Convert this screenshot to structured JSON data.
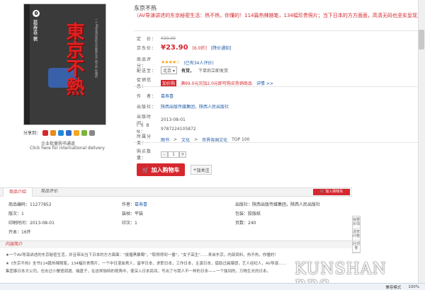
{
  "product": {
    "title": "东京不热",
    "promo": "（AV导演讲述的东京秘密生活：热不热，你懂的！114篇热辣随笔，134幅珍贵照片；当下日本的方方面面，高清无码也坚实呈现）",
    "list_price_label": "定　价：",
    "list_price": "¥30.00",
    "price_label": "京东价：",
    "price": "¥23.90",
    "discount": "[6.0折]",
    "price_notice": "[降价通知]",
    "rating_label": "商品评分：",
    "rating_stars": 4,
    "rating_text": "(已有34人评价)",
    "ship_label": "配送至：",
    "ship_region": "北京",
    "ship_stock": "有货，",
    "ship_note": "下单后立即发货",
    "promo_label": "促销信息：",
    "promo_tag": "加价购",
    "promo_text": "满99.0元另加2.0元即可购买热销商品",
    "promo_link": "详情 >>",
    "author_label": "作　者：",
    "author": "葛寿喜",
    "publisher_label": "出版社：",
    "publisher": "陕西出版传媒集团，陕西人民出版社",
    "pubdate_label": "出版时间：",
    "pubdate": "2013-08-01",
    "isbn_label": "I S B N：",
    "isbn": "9787224105872",
    "category_label": "所属分类：",
    "category": [
      "图书",
      "文化",
      "世界各国文化"
    ],
    "category_sep": ">",
    "category_rank": "TOP 100",
    "qty_label": "购买数量：",
    "qty_minus": "-",
    "qty_value": "1",
    "qty_plus": "+",
    "cart_button": "加入购物车",
    "fav_button": "加关注"
  },
  "cover": {
    "number": "0",
    "big_title": "東京不熱",
    "side_text": "葛寿喜·著",
    "small_text": "一个AV导演讲述的东京秘密生活 热不热 你懂的"
  },
  "share": {
    "label": "分享到：",
    "icon_colors": [
      "#d4282e",
      "#e88a1a",
      "#1f8ad8",
      "#2f6bc7",
      "#f5a623",
      "#7ab339",
      "#888888"
    ]
  },
  "corporate": {
    "line1": "企业批量购书通道",
    "line2": "Click here for international delivery"
  },
  "tabs": {
    "intro": "商品介绍",
    "reviews": "商品评价",
    "add_cart": "加入购物车"
  },
  "details": {
    "rows": [
      [
        [
          "商品编码：",
          "11277852"
        ],
        [
          "作者：",
          "葛寿喜"
        ],
        [
          "出版社：",
          "陕西出版传媒集团，陕西人民出版社"
        ]
      ],
      [
        [
          "版次：",
          "1"
        ],
        [
          "装帧：",
          "平装"
        ],
        [
          "包装：",
          "胶版纸"
        ]
      ],
      [
        [
          "印刷时间：",
          "2013-08-01"
        ],
        [
          "印次：",
          "1"
        ],
        [
          "页数：",
          "240"
        ]
      ],
      [
        [
          "开本：",
          "16开"
        ],
        [
          "",
          ""
        ],
        [
          "",
          ""
        ]
      ]
    ]
  },
  "intro": {
    "section_title": "内容简介",
    "line1": "★一个AV导演讲述的东京秘密生活，并且带出当下日本的方方面面：\"拔搐黑暴蜀\"，\"取得得到一番\"，\"女子高生\"……来自东京，内部资料，热不热，你懂的！",
    "line2": "★《东京不热》全书114篇热辣随笔，134幅珍贵照片，一个中日混血男人，留学日本，求职日本，工作日本，主演日本，借助过晨爆感，艺人经纪人，AV导演……",
    "line3": "集团事日本大公司，也去过小餐馆调酒、端盘子，在这样独特的视角中，使深入日本民间，写出了与我人不一样的日本——一个独到的，万物生长的日本。"
  },
  "float_bar": {
    "item1": "我要反馈",
    "item2": "调查问卷",
    "item3": "回顶部"
  },
  "statusbar": {
    "mode": "兼容模式",
    "zoom": "100%"
  },
  "watermark": "KUNSHAN BBS"
}
